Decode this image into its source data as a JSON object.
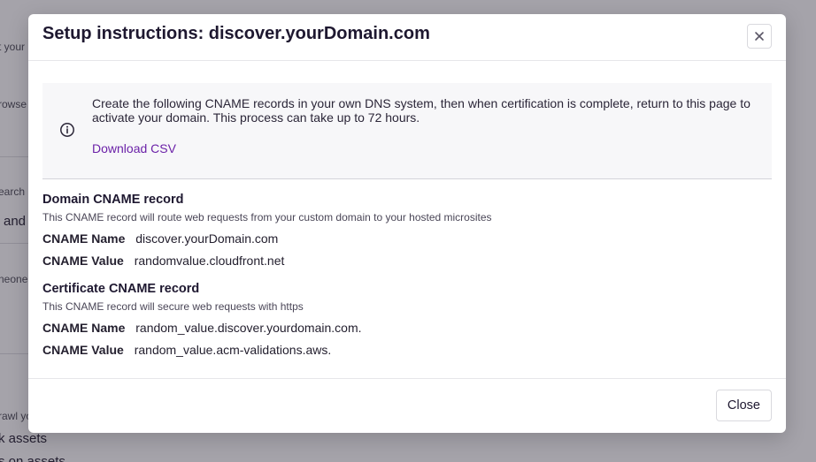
{
  "background": {
    "fragments": [
      "t your",
      "rowse",
      "earch",
      "and",
      "neone",
      "rawl yo",
      "k assets",
      "s on assets"
    ]
  },
  "modal": {
    "title": "Setup instructions: discover.yourDomain.com",
    "close_icon": "close-icon",
    "info": {
      "icon": "info-circle-icon",
      "text": "Create the following CNAME records in your own DNS system, then when certification is complete, return to this page to activate your domain. This process can take up to 72 hours.",
      "link_label": "Download CSV"
    },
    "domain_record": {
      "title": "Domain CNAME record",
      "description": "This CNAME record will route web requests from your custom domain to your hosted microsites",
      "name_label": "CNAME Name",
      "name_value": "discover.yourDomain.com",
      "value_label": "CNAME Value",
      "value_value": "randomvalue.cloudfront.net"
    },
    "certificate_record": {
      "title": "Certificate CNAME record",
      "description": "This CNAME record will secure web requests with https",
      "name_label": "CNAME Name",
      "name_value": "random_value.discover.yourdomain.com.",
      "value_label": "CNAME Value",
      "value_value": "random_value.acm-validations.aws."
    },
    "footer": {
      "close_label": "Close"
    }
  },
  "colors": {
    "overlay": "#28243480",
    "link": "#6b21a8",
    "title": "#1e1830"
  }
}
